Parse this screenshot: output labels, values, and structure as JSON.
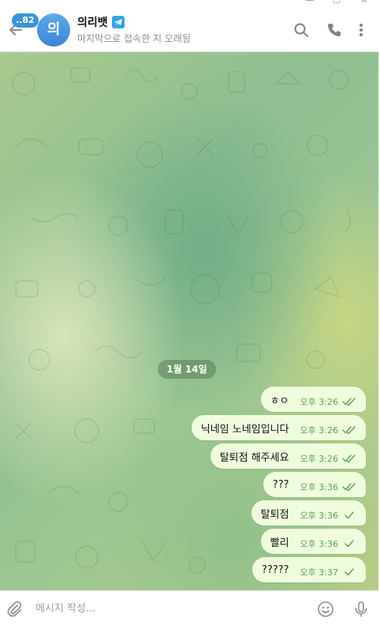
{
  "window": {
    "minimize_glyph": "—",
    "maximize_glyph": "☐",
    "close_glyph": "✕"
  },
  "header": {
    "unread_badge": "..82",
    "avatar_initial": "의",
    "title": "의리뱃",
    "status": "마지막으로 접속한 지 오래됨",
    "icons": [
      "back-arrow-icon",
      "telegram-icon",
      "search-icon",
      "phone-icon",
      "more-vertical-icon"
    ]
  },
  "chat": {
    "date_label": "1월 14일",
    "messages": [
      {
        "text": "ㅎㅇ",
        "time": "오후 3:26",
        "status": "read"
      },
      {
        "text": "닉네임 노네임입니다",
        "time": "오후 3:26",
        "status": "read"
      },
      {
        "text": "탈퇴점 해주세요",
        "time": "오후 3:26",
        "status": "read"
      },
      {
        "text": "???",
        "time": "오후 3:36",
        "status": "read"
      },
      {
        "text": "탈퇴점",
        "time": "오후 3:36",
        "status": "sent"
      },
      {
        "text": "빨리",
        "time": "오후 3:36",
        "status": "sent"
      },
      {
        "text": "?????",
        "time": "오후 3:37",
        "status": "sent"
      }
    ]
  },
  "composer": {
    "placeholder": "메시지 작성...",
    "value": "",
    "icons": [
      "paperclip-icon",
      "emoji-icon",
      "microphone-icon"
    ]
  },
  "colors": {
    "accent": "#3a94d8",
    "bubble": "#effdde",
    "time_text": "#5fa35a"
  }
}
